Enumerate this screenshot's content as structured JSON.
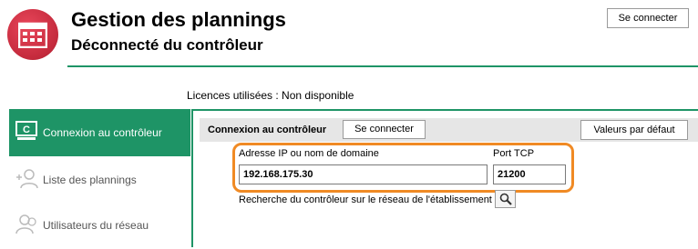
{
  "header": {
    "title": "Gestion des plannings",
    "subtitle": "Déconnecté du contrôleur",
    "connect_label": "Se connecter",
    "app_icon": "calendar-icon"
  },
  "licences": "Licences utilisées : Non disponible",
  "sidebar": {
    "items": [
      {
        "label": "Connexion au contrôleur",
        "icon": "controller-icon",
        "active": true
      },
      {
        "label": "Liste des plannings",
        "icon": "user-add-icon",
        "active": false
      },
      {
        "label": "Utilisateurs du réseau",
        "icon": "users-icon",
        "active": false
      }
    ]
  },
  "panel": {
    "heading": "Connexion au contrôleur",
    "connect_label": "Se connecter",
    "defaults_label": "Valeurs par défaut",
    "ip_label": "Adresse IP ou nom de domaine",
    "ip_value": "192.168.175.30",
    "port_label": "Port TCP",
    "port_value": "21200",
    "search_label": "Recherche du contrôleur sur le réseau de l'établissement"
  },
  "colors": {
    "accent": "#1e9466",
    "highlight": "#f08a24",
    "brand": "#c42a3c"
  }
}
